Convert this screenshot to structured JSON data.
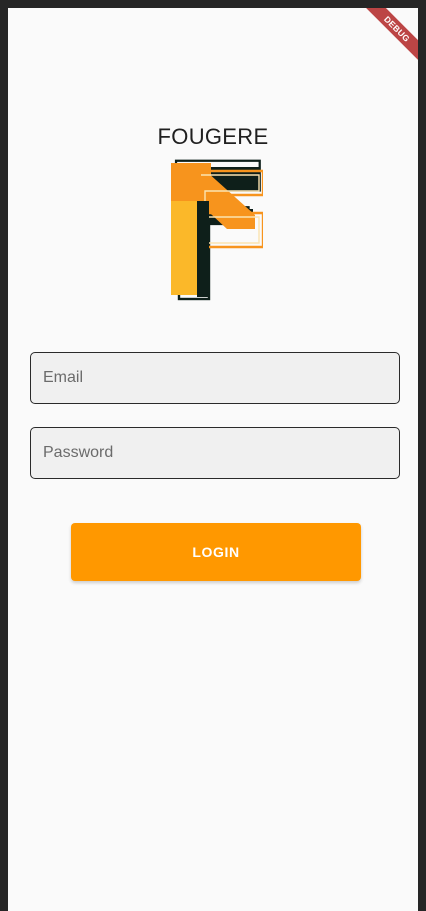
{
  "app": {
    "title": "FOUGERE",
    "debug_banner": "DEBUG",
    "logo_icon": "fougere-f-logo-icon"
  },
  "form": {
    "email_placeholder": "Email",
    "email_value": "",
    "password_placeholder": "Password",
    "password_value": ""
  },
  "actions": {
    "login_label": "LOGIN"
  },
  "colors": {
    "accent": "#ff9800",
    "logo_orange": "#f7941d",
    "logo_yellow": "#fbb829",
    "logo_dark": "#0e1f1a",
    "background": "#fafafa",
    "field_fill": "#f0f0f0"
  }
}
